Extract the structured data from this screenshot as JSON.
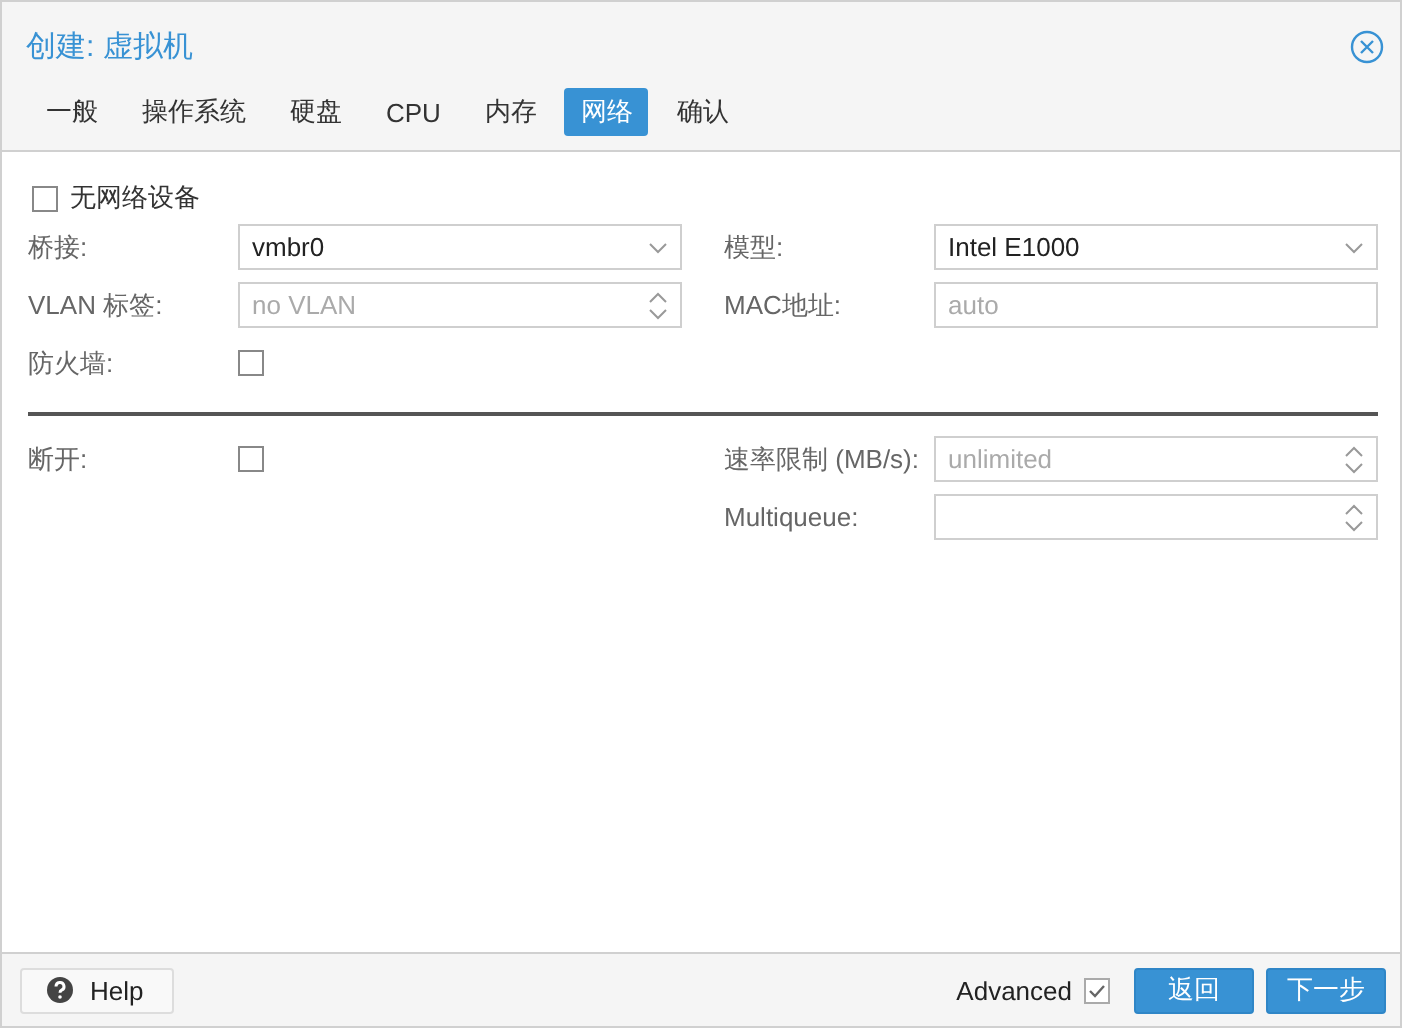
{
  "window": {
    "title": "创建: 虚拟机"
  },
  "tabs": [
    {
      "label": "一般",
      "selected": false
    },
    {
      "label": "操作系统",
      "selected": false
    },
    {
      "label": "硬盘",
      "selected": false
    },
    {
      "label": "CPU",
      "selected": false
    },
    {
      "label": "内存",
      "selected": false
    },
    {
      "label": "网络",
      "selected": true
    },
    {
      "label": "确认",
      "selected": false
    }
  ],
  "no_network_device": {
    "label": "无网络设备",
    "checked": false
  },
  "sections": [
    {
      "left": [
        {
          "kind": "select",
          "label": "桥接:",
          "value": "vmbr0"
        },
        {
          "kind": "spinner",
          "label": "VLAN 标签:",
          "placeholder": "no VLAN"
        },
        {
          "kind": "checkbox",
          "label": "防火墙:",
          "checked": false
        }
      ],
      "right": [
        {
          "kind": "select",
          "label": "模型:",
          "value": "Intel E1000"
        },
        {
          "kind": "text",
          "label": "MAC地址:",
          "placeholder": "auto"
        }
      ]
    },
    {
      "left": [
        {
          "kind": "checkbox",
          "label": "断开:",
          "checked": false
        }
      ],
      "right": [
        {
          "kind": "spinner",
          "label": "速率限制 (MB/s):",
          "placeholder": "unlimited"
        },
        {
          "kind": "spinner",
          "label": "Multiqueue:"
        }
      ]
    }
  ],
  "footer": {
    "help": "Help",
    "advanced": {
      "label": "Advanced",
      "checked": true
    },
    "buttons": [
      "返回",
      "下一步"
    ]
  }
}
